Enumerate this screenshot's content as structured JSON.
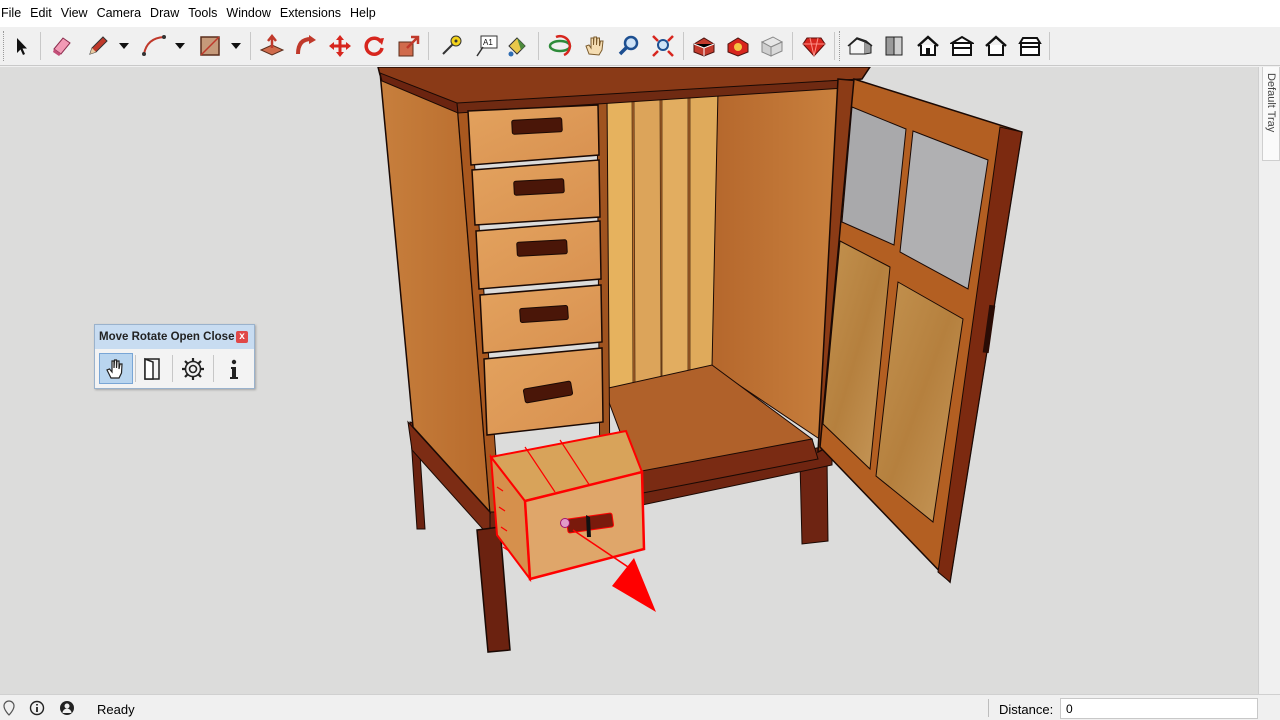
{
  "menu": [
    "File",
    "Edit",
    "View",
    "Camera",
    "Draw",
    "Tools",
    "Window",
    "Extensions",
    "Help"
  ],
  "toolbar": {
    "tools": [
      {
        "name": "select-tool",
        "icon": "arrow-pointer-icon"
      },
      {
        "name": "eraser-tool",
        "icon": "eraser-icon"
      },
      {
        "name": "line-tool",
        "icon": "pencil-icon"
      },
      {
        "name": "arc-tool",
        "icon": "arc-icon"
      },
      {
        "name": "rectangle-tool",
        "icon": "rectangle-icon"
      },
      {
        "name": "push-pull-tool",
        "icon": "push-pull-icon"
      },
      {
        "name": "follow-me-tool",
        "icon": "follow-me-icon"
      },
      {
        "name": "move-tool",
        "icon": "move-icon"
      },
      {
        "name": "rotate-tool",
        "icon": "rotate-icon"
      },
      {
        "name": "scale-tool",
        "icon": "scale-icon"
      },
      {
        "name": "tape-measure-tool",
        "icon": "tape-measure-icon"
      },
      {
        "name": "text-tool",
        "icon": "text-icon"
      },
      {
        "name": "paint-bucket-tool",
        "icon": "paint-bucket-icon"
      },
      {
        "name": "orbit-tool",
        "icon": "orbit-icon"
      },
      {
        "name": "pan-tool",
        "icon": "hand-icon"
      },
      {
        "name": "zoom-tool",
        "icon": "magnifier-icon"
      },
      {
        "name": "zoom-extents-tool",
        "icon": "zoom-extents-icon"
      },
      {
        "name": "3d-warehouse",
        "icon": "warehouse-icon"
      },
      {
        "name": "extension-warehouse",
        "icon": "extension-icon"
      },
      {
        "name": "layout-send",
        "icon": "layout-icon"
      },
      {
        "name": "ruby-console",
        "icon": "ruby-icon"
      },
      {
        "name": "iso-view",
        "icon": "iso-house-icon"
      },
      {
        "name": "top-view",
        "icon": "top-view-icon"
      },
      {
        "name": "front-view",
        "icon": "front-house-icon"
      },
      {
        "name": "right-view",
        "icon": "right-house-icon"
      },
      {
        "name": "back-view",
        "icon": "back-house-icon"
      },
      {
        "name": "left-view",
        "icon": "left-house-icon"
      }
    ]
  },
  "plugin_panel": {
    "title": "Move Rotate Open Close",
    "close_label": "x",
    "buttons": [
      {
        "name": "move-open-button",
        "icon": "hand-icon",
        "active": true
      },
      {
        "name": "door-button",
        "icon": "door-icon",
        "active": false
      },
      {
        "name": "settings-button",
        "icon": "gear-icon",
        "active": false
      },
      {
        "name": "info-button",
        "icon": "info-icon",
        "active": false
      }
    ]
  },
  "tray": {
    "label": "Default Tray"
  },
  "status": {
    "text": "Ready",
    "measure_label": "Distance:",
    "measure_value": "0"
  },
  "colors": {
    "wood_light": "#c98a4a",
    "wood_dark": "#7a2c12",
    "birch": "#e2b060",
    "selection": "#ff0000",
    "viewport_bg": "#dcdcdb"
  }
}
